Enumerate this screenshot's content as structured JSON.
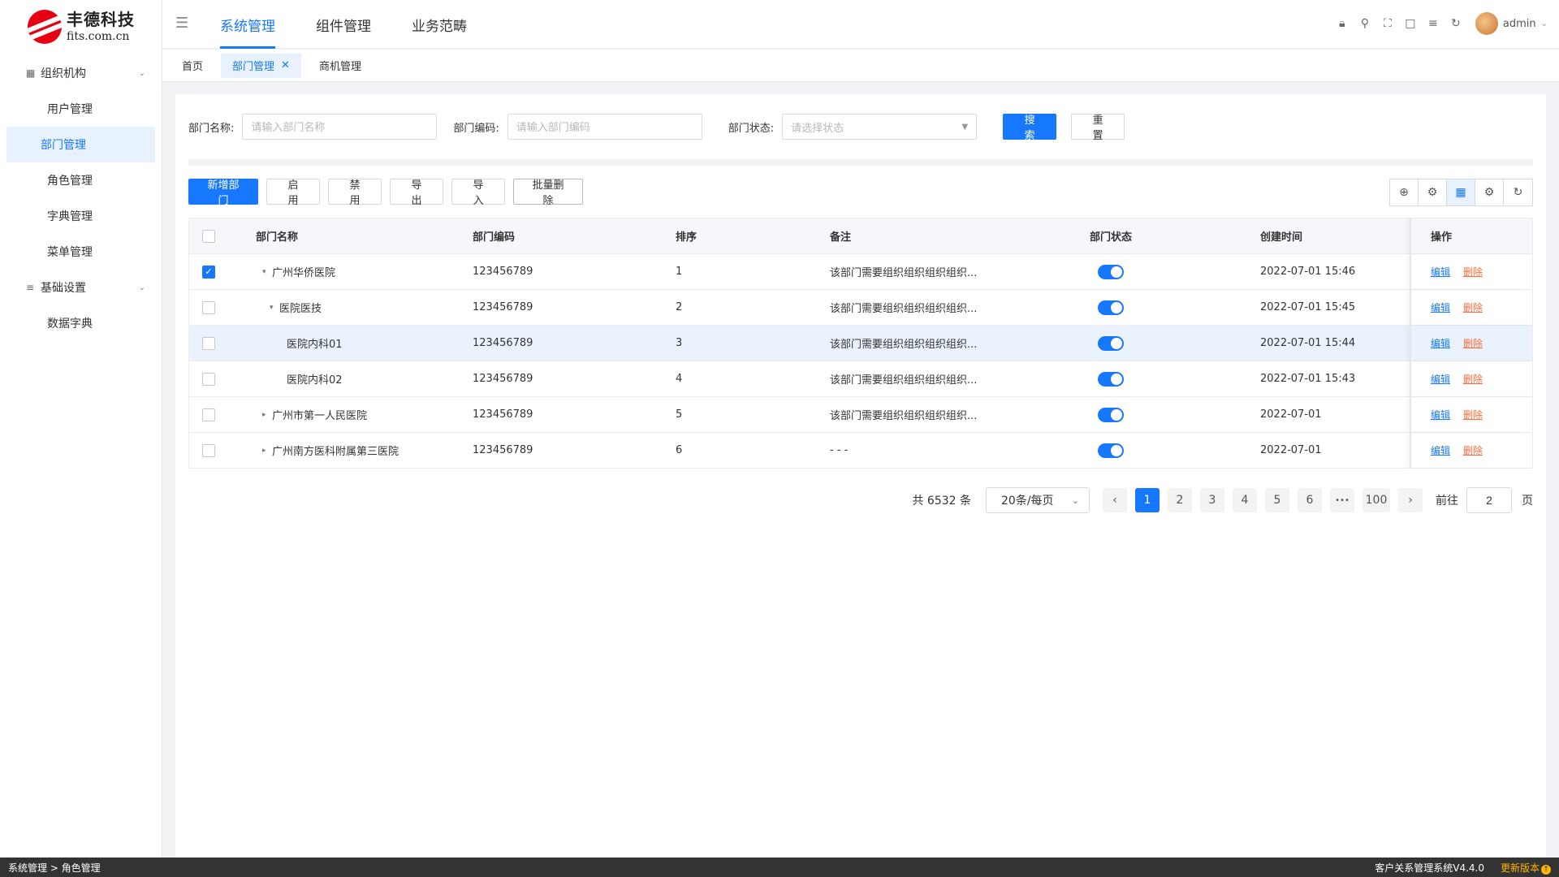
{
  "brand": {
    "name_cn": "丰德科技",
    "domain": "fits.com.cn"
  },
  "sidebar": {
    "groups": [
      {
        "label": "组织机构",
        "icon": "org-chart-icon",
        "items": [
          "用户管理",
          "部门管理",
          "角色管理",
          "字典管理",
          "菜单管理"
        ]
      },
      {
        "label": "基础设置",
        "icon": "sliders-icon",
        "items": [
          "数据字典"
        ]
      }
    ],
    "active_item": "部门管理"
  },
  "topnav": {
    "tabs": [
      "系统管理",
      "组件管理",
      "业务范畴"
    ],
    "active": "系统管理",
    "user": "admin"
  },
  "pagetabs": {
    "tabs": [
      "首页",
      "部门管理",
      "商机管理"
    ],
    "active": "部门管理"
  },
  "filters": {
    "name_label": "部门名称:",
    "name_placeholder": "请输入部门名称",
    "code_label": "部门编码:",
    "code_placeholder": "请输入部门编码",
    "status_label": "部门状态:",
    "status_placeholder": "请选择状态",
    "search": "搜索",
    "reset": "重置"
  },
  "toolbar": {
    "add": "新增部门",
    "enable": "启用",
    "disable": "禁用",
    "export": "导出",
    "import": "导入",
    "batch_delete": "批量删除"
  },
  "table": {
    "columns": {
      "name": "部门名称",
      "code": "部门编码",
      "sort": "排序",
      "note": "备注",
      "status": "部门状态",
      "time": "创建时间",
      "op": "操作"
    },
    "rows": [
      {
        "name": "广州华侨医院",
        "code": "123456789",
        "sort": "1",
        "note": "该部门需要组织组织组织组织...",
        "status": true,
        "time": "2022-07-01 15:46",
        "checked": true,
        "level": 0,
        "expander": "open"
      },
      {
        "name": "医院医技",
        "code": "123456789",
        "sort": "2",
        "note": "该部门需要组织组织组织组织...",
        "status": true,
        "time": "2022-07-01 15:45",
        "checked": false,
        "level": 1,
        "expander": "open"
      },
      {
        "name": "医院内科01",
        "code": "123456789",
        "sort": "3",
        "note": "该部门需要组织组织组织组织...",
        "status": true,
        "time": "2022-07-01 15:44",
        "checked": false,
        "level": 2,
        "expander": "none",
        "highlight": true
      },
      {
        "name": "医院内科02",
        "code": "123456789",
        "sort": "4",
        "note": "该部门需要组织组织组织组织...",
        "status": true,
        "time": "2022-07-01 15:43",
        "checked": false,
        "level": 2,
        "expander": "none"
      },
      {
        "name": "广州市第一人民医院",
        "code": "123456789",
        "sort": "5",
        "note": "该部门需要组织组织组织组织...",
        "status": true,
        "time": "2022-07-01",
        "checked": false,
        "level": 0,
        "expander": "closed"
      },
      {
        "name": "广州南方医科附属第三医院",
        "code": "123456789",
        "sort": "6",
        "note": "- - -",
        "status": true,
        "time": "2022-07-01",
        "checked": false,
        "level": 0,
        "expander": "closed"
      }
    ],
    "op_edit": "编辑",
    "op_delete": "删除"
  },
  "pagination": {
    "total": "共 6532 条",
    "page_size": "20条/每页",
    "pages": [
      "1",
      "2",
      "3",
      "4",
      "5",
      "6"
    ],
    "ellipsis": "•••",
    "last": "100",
    "current": "1",
    "goto_label": "前往",
    "goto_value": "2",
    "goto_suffix": "页"
  },
  "statusbar": {
    "breadcrumb": "系统管理 > 角色管理",
    "version": "客户关系管理系统V4.4.0",
    "update": "更新版本"
  },
  "colors": {
    "primary": "#1677ff",
    "danger": "#ff6a3d",
    "statusbar_bg": "#333333",
    "highlight_row": "#eaf3fd"
  }
}
